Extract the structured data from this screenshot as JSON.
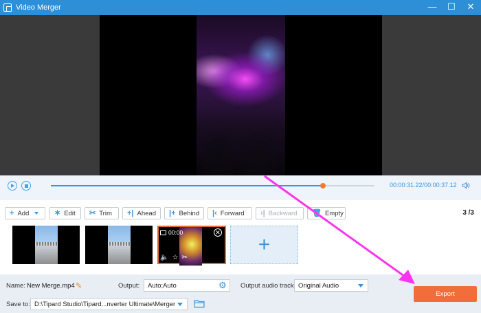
{
  "window": {
    "title": "Video Merger",
    "minimize": "—",
    "maximize": "☐",
    "close": "✕"
  },
  "player": {
    "current_time": "00:00:31.22",
    "separator": "/",
    "total_time": "00:00:37.12",
    "progress": 0.84
  },
  "toolbar": {
    "add": "Add",
    "edit": "Edit",
    "trim": "Trim",
    "ahead": "Ahead",
    "behind": "Behind",
    "forward": "Forward",
    "backward": "Backward",
    "empty": "Empty",
    "pager": "3 /3"
  },
  "clips": [
    {
      "selected": false
    },
    {
      "selected": false
    },
    {
      "selected": true,
      "duration": "00:00"
    }
  ],
  "bottom": {
    "name_label": "Name:",
    "name_value": "New Merge.mp4",
    "output_label": "Output:",
    "output_value": "Auto;Auto",
    "audio_label": "Output audio track:",
    "audio_value": "Original Audio",
    "save_label": "Save to:",
    "save_path": "D:\\Tipard Studio\\Tipard...nverter Ultimate\\Merger",
    "export": "Export"
  },
  "colors": {
    "title_bar": "#2e8fd9",
    "accent": "#3a94dc",
    "export": "#f16e3a",
    "annotation_arrow": "#ff33ee"
  }
}
